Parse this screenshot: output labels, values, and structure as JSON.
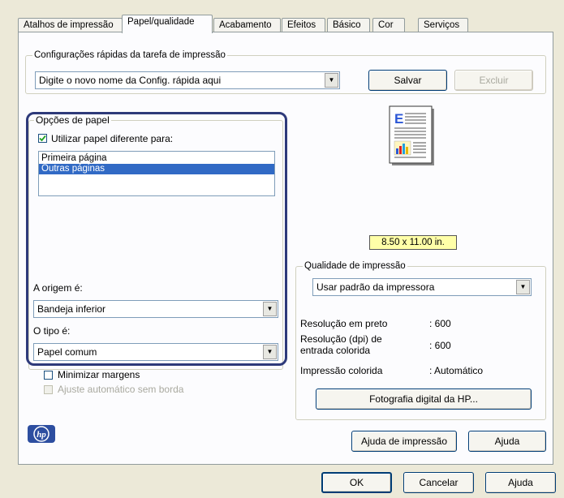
{
  "tabs": [
    {
      "label": "Atalhos de impressão"
    },
    {
      "label": "Papel/qualidade"
    },
    {
      "label": "Acabamento"
    },
    {
      "label": "Efeitos"
    },
    {
      "label": "Básico"
    },
    {
      "label": "Cor"
    },
    {
      "label": "Serviços"
    }
  ],
  "quick_settings": {
    "title": "Configurações rápidas da tarefa de impressão",
    "combo_value": "Digite o novo nome da Config. rápida aqui",
    "save_label": "Salvar",
    "delete_label": "Excluir"
  },
  "paper_options": {
    "title": "Opções de papel",
    "use_different_label": "Utilizar papel diferente para:",
    "use_different_checked": true,
    "pages": [
      "Primeira página",
      "Outras páginas"
    ],
    "selected_page": "Outras páginas",
    "source_label": "A origem é:",
    "source_value": "Bandeja inferior",
    "type_label": "O tipo é:",
    "type_value": "Papel comum",
    "minimize_margins_label": "Minimizar margens",
    "minimize_margins_checked": false,
    "borderless_label": "Ajuste automático sem borda",
    "borderless_checked": false
  },
  "preview": {
    "paper_size": "8.50 x 11.00 in."
  },
  "print_quality": {
    "title": "Qualidade de impressão",
    "combo_value": "Usar padrão da impressora",
    "black_res_label": "Resolução em preto",
    "black_res_value": ": 600",
    "color_res_label_line1": "Resolução (dpi) de",
    "color_res_label_line2": "entrada colorida",
    "color_res_value": ": 600",
    "color_print_label": "Impressão colorida",
    "color_print_value": ": Automático",
    "hp_photo_button": "Fotografia digital da HP..."
  },
  "footer": {
    "print_help_button": "Ajuda de impressão",
    "help_button": "Ajuda"
  },
  "dialog_buttons": {
    "ok": "OK",
    "cancel": "Cancelar",
    "help": "Ajuda"
  },
  "colors": {
    "highlight_frame": "#2E3A7A",
    "selection": "#316AC5",
    "paper_size_bg": "#FFFFA8"
  }
}
